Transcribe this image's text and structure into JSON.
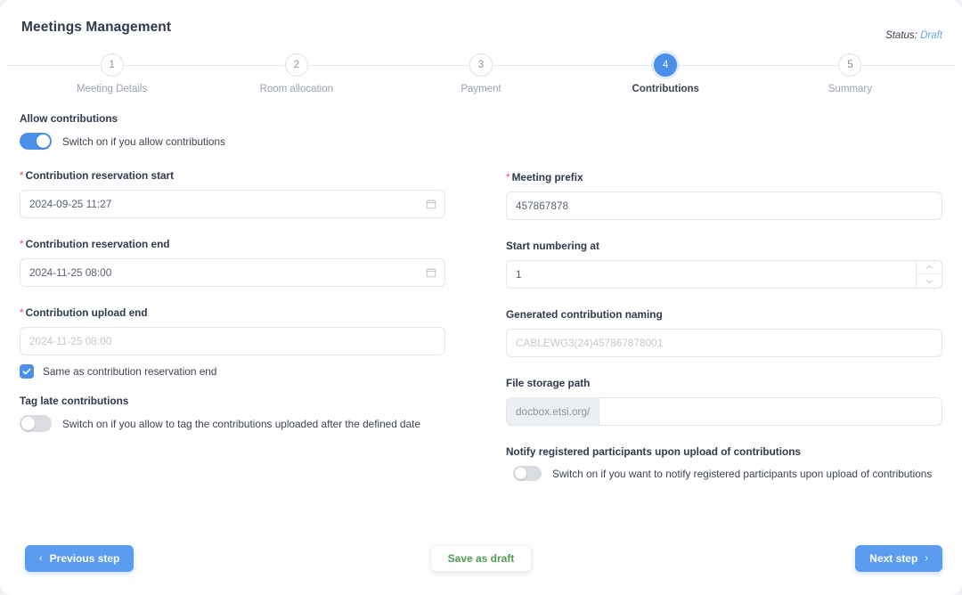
{
  "header": {
    "title": "Meetings Management",
    "status_label": "Status:",
    "status_value": "Draft"
  },
  "stepper": {
    "steps": [
      {
        "number": "1",
        "label": "Meeting Details"
      },
      {
        "number": "2",
        "label": "Room allocation"
      },
      {
        "number": "3",
        "label": "Payment"
      },
      {
        "number": "4",
        "label": "Contributions"
      },
      {
        "number": "5",
        "label": "Summary"
      }
    ],
    "active_index": 3
  },
  "left": {
    "allow_contributions": {
      "label": "Allow contributions",
      "toggle_text": "Switch on if you allow contributions",
      "state": "on"
    },
    "reservation_start": {
      "label": "Contribution reservation start",
      "required": "*",
      "value": "2024-09-25 11:27",
      "icon": "calendar-icon"
    },
    "reservation_end": {
      "label": "Contribution reservation end",
      "required": "*",
      "value": "2024-11-25 08:00",
      "icon": "calendar-icon"
    },
    "upload_end": {
      "label": "Contribution upload end",
      "required": "*",
      "value": "2024-11-25 08:00",
      "disabled": true,
      "checkbox_label": "Same as contribution reservation end",
      "checkbox_state": "checked"
    },
    "tag_late": {
      "label": "Tag late contributions",
      "toggle_text": "Switch on if you allow to tag the contributions uploaded after the defined date",
      "state": "off"
    }
  },
  "right": {
    "meeting_prefix": {
      "label": "Meeting prefix",
      "required": "*",
      "value": "457867878"
    },
    "start_numbering": {
      "label": "Start numbering at",
      "value": "1",
      "spinner_up": "chevron-up-icon",
      "spinner_down": "chevron-down-icon"
    },
    "generated_naming": {
      "label": "Generated contribution naming",
      "value": "CABLEWG3(24)457867878001",
      "disabled": true
    },
    "file_storage_path": {
      "label": "File storage path",
      "addon": "docbox.etsi.org/",
      "value": ""
    },
    "notify": {
      "label": "Notify registered participants upon upload of contributions",
      "toggle_text": "Switch on if you want to notify registered participants upon upload of contributions",
      "state": "off"
    }
  },
  "footer": {
    "previous_label": "Previous step",
    "previous_icon": "chevron-left-icon",
    "draft_label": "Save as draft",
    "next_label": "Next step",
    "next_icon": "chevron-right-icon"
  },
  "colors": {
    "accent": "#4a90e8",
    "button": "#5b9bf0",
    "required": "#f04b6e",
    "draft_text": "#4f9d4f",
    "status": "#6ca2e8"
  }
}
